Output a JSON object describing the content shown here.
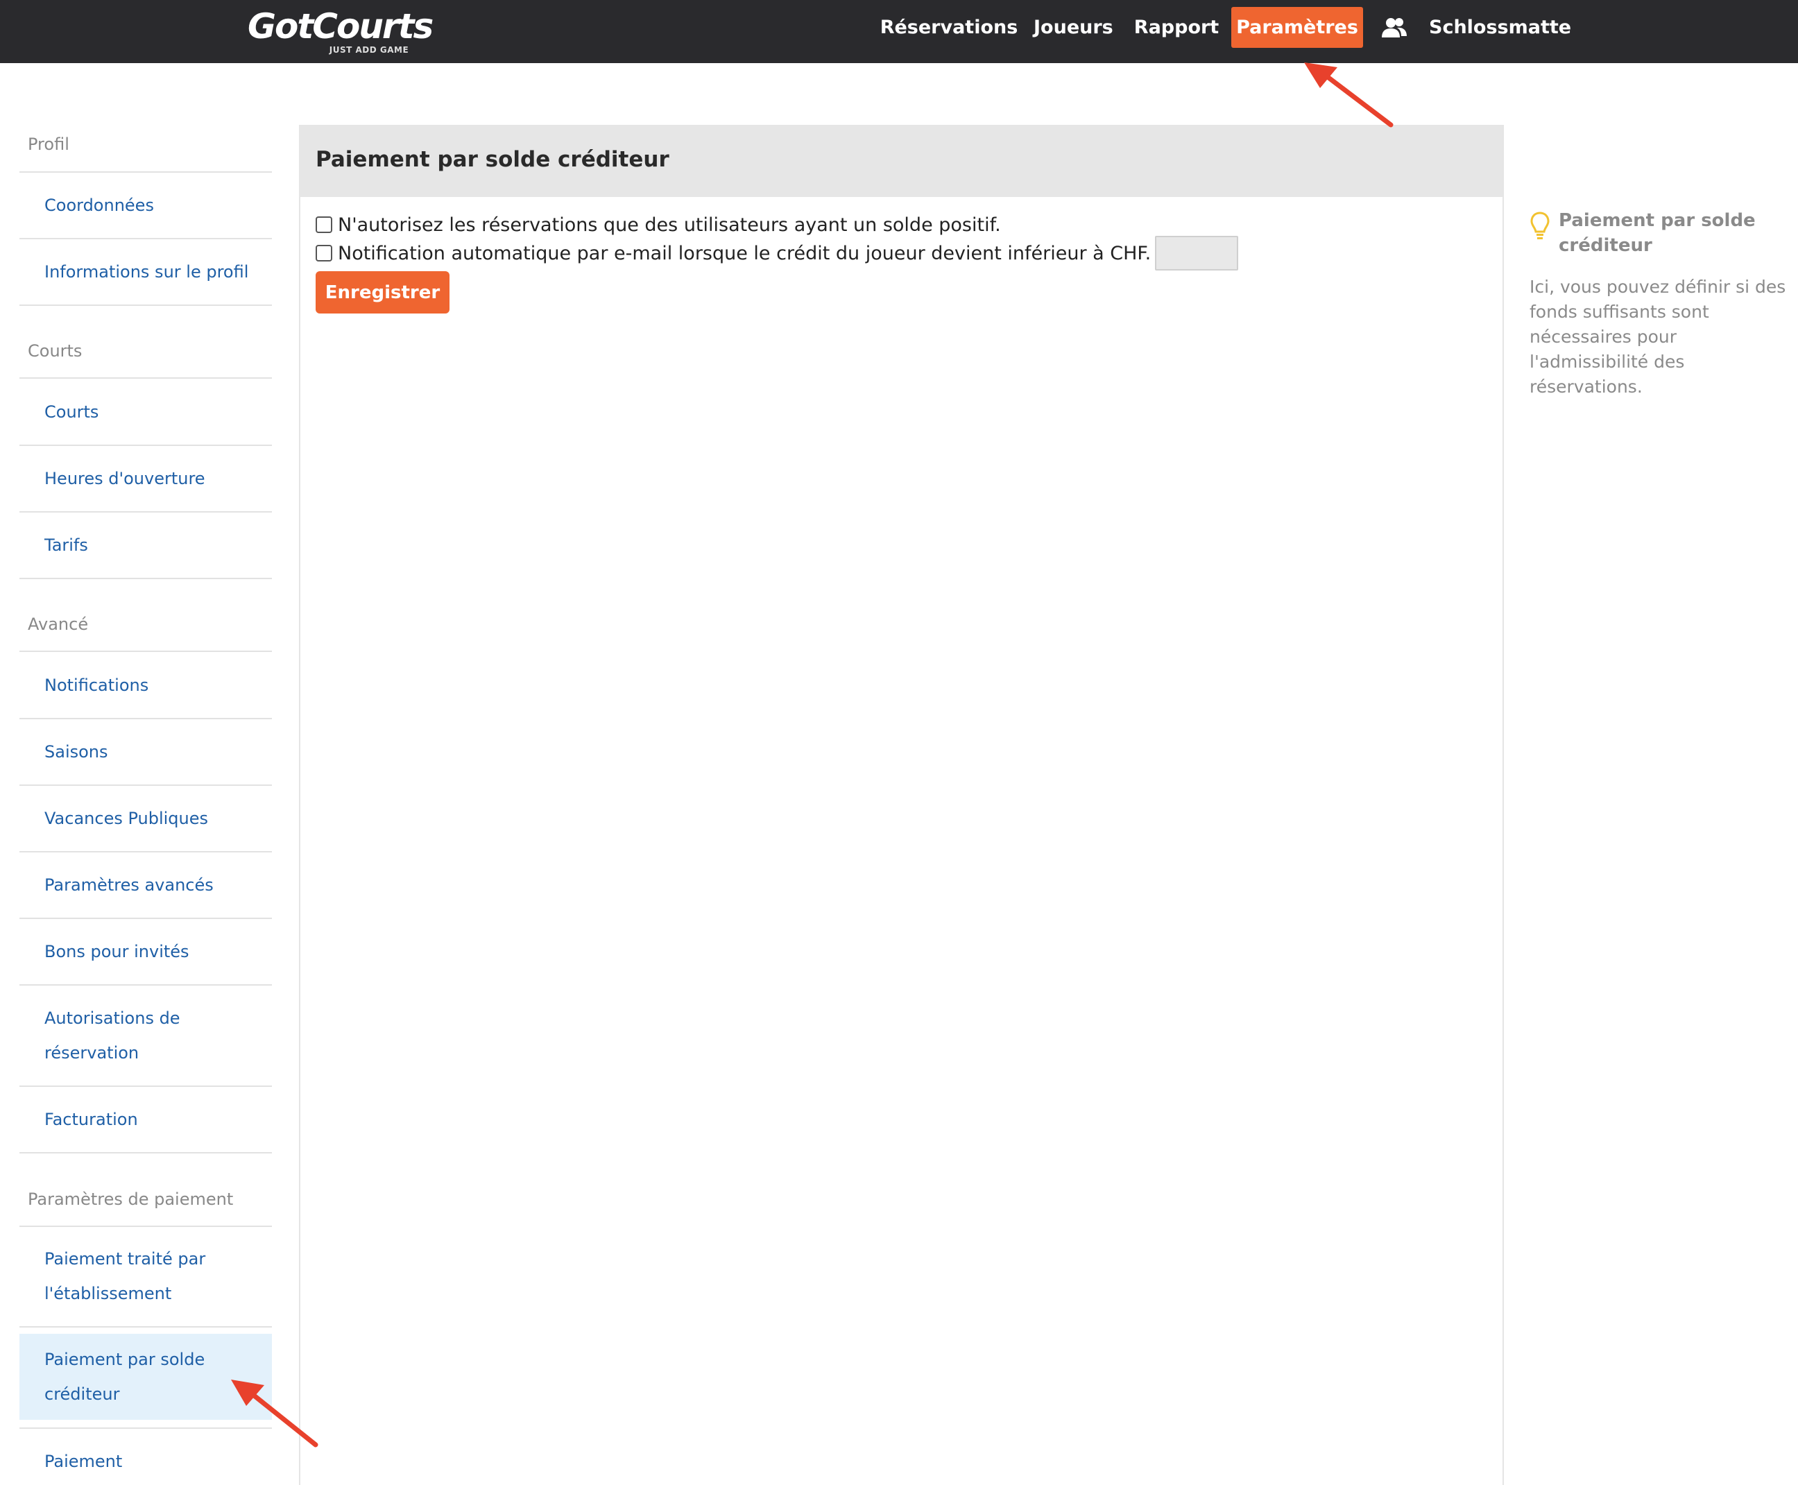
{
  "brand": {
    "name": "GotCourts",
    "tagline": "JUST ADD GAME"
  },
  "nav": {
    "items": [
      {
        "label": "Réservations",
        "active": false
      },
      {
        "label": "Joueurs",
        "active": false
      },
      {
        "label": "Rapport",
        "active": false
      },
      {
        "label": "Paramètres",
        "active": true
      }
    ],
    "users_icon": "users-icon",
    "club": "Schlossmatte"
  },
  "sidebar": {
    "sections": [
      {
        "label": "Profil",
        "items": [
          "Coordonnées",
          "Informations sur le profil"
        ]
      },
      {
        "label": "Courts",
        "items": [
          "Courts",
          "Heures d'ouverture",
          "Tarifs"
        ]
      },
      {
        "label": "Avancé",
        "items": [
          "Notifications",
          "Saisons",
          "Vacances Publiques",
          "Paramètres avancés",
          "Bons pour invités",
          "Autorisations de réservation",
          "Facturation"
        ]
      },
      {
        "label": "Paramètres de paiement",
        "items": [
          "Paiement traité par l'établissement",
          "Paiement par solde créditeur",
          "Paiement"
        ]
      }
    ],
    "active_item": "Paiement par solde créditeur"
  },
  "main": {
    "title": "Paiement par solde créditeur",
    "options": [
      {
        "label": "N'autorisez les réservations que des utilisateurs ayant un solde positif.",
        "checked": false
      },
      {
        "label": "Notification automatique par e-mail lorsque le crédit du joueur devient inférieur à CHF.",
        "checked": false
      }
    ],
    "chf_value": "",
    "save_label": "Enregistrer"
  },
  "help": {
    "icon": "lightbulb-icon",
    "title": "Paiement par solde créditeur",
    "text": "Ici, vous pouvez définir si des fonds suffisants sont nécessaires pour l'admissibilité des réservations."
  },
  "colors": {
    "accent": "#ef6530",
    "topbar": "#2a2a2d",
    "link": "#1f5fa6",
    "active_bg": "#e3f1fb",
    "annotation": "#e8412c"
  }
}
